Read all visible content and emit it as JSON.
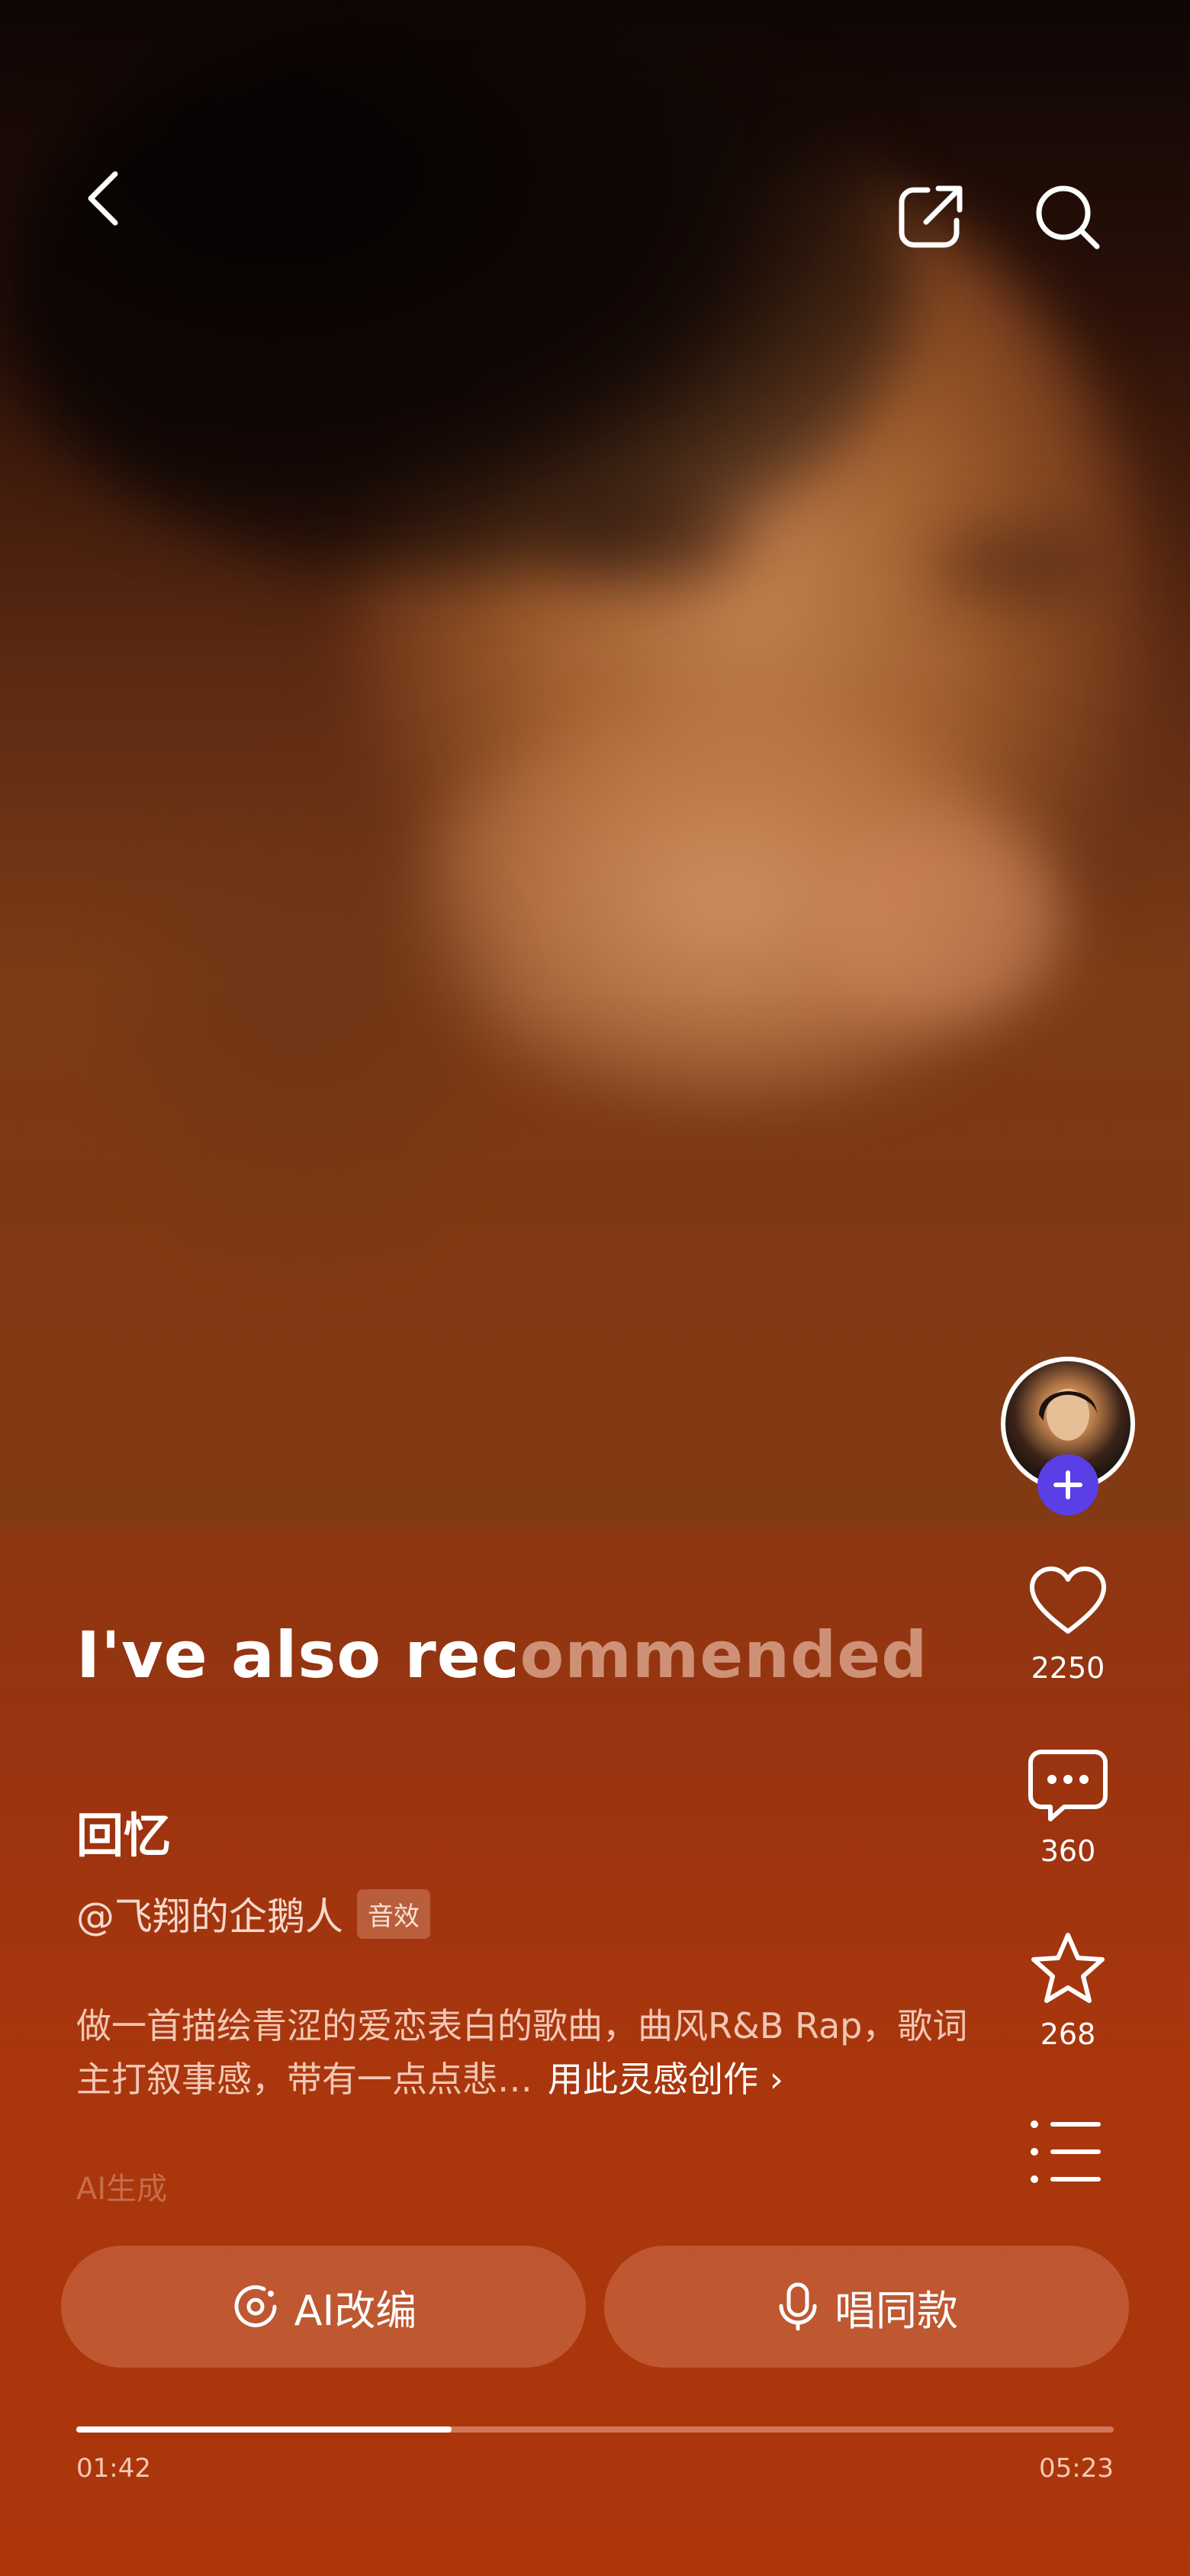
{
  "header": {
    "back_icon": "chevron-left-icon",
    "share_icon": "share-icon",
    "search_icon": "search-icon"
  },
  "headline": {
    "bright": "I've also rec",
    "dim": "ommended"
  },
  "song": {
    "title": "回忆",
    "author": "@飞翔的企鹅人",
    "badge": "音效",
    "description": "做一首描绘青涩的爱恋表白的歌曲，曲风R&B Rap，歌词主打叙事感，带有一点点悲…",
    "create_link": "用此灵感创作 ›",
    "ai_tag": "AI生成"
  },
  "actions": {
    "likes": "2250",
    "comments": "360",
    "favorites": "268"
  },
  "buttons": {
    "ai_remix": "AI改编",
    "sing_same": "唱同款"
  },
  "player": {
    "current_time": "01:42",
    "total_time": "05:23",
    "progress": 0.362
  },
  "colors": {
    "follow_button": "#5a3ee6",
    "background_bottom": "#ad360b"
  }
}
